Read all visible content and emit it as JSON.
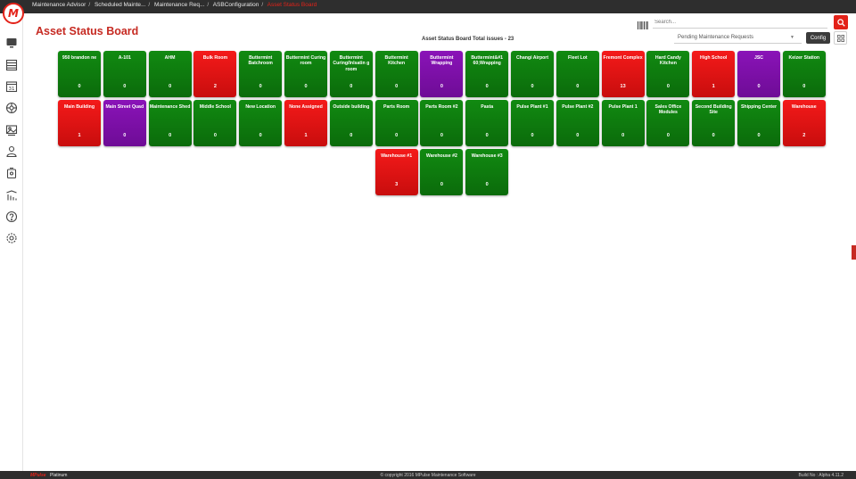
{
  "header": {
    "breadcrumbs": [
      "Maintenance Advisor",
      "Scheduled Mainte...",
      "Maintenance Req...",
      "ASBConfiguration"
    ],
    "current_page": "Asset Status Board"
  },
  "sidebar": {
    "icons": [
      "monitor-icon",
      "list-icon",
      "calendar-icon",
      "asset-icon",
      "gallery-icon",
      "user-icon",
      "inventory-icon",
      "reports-icon",
      "help-icon",
      "settings-icon"
    ],
    "calendar_day": "31"
  },
  "page": {
    "title": "Asset Status Board",
    "total_issues": "Asset Status Board Total issues - 23"
  },
  "search": {
    "placeholder": "Search..."
  },
  "filter": {
    "selected": "Pending Maintenance Requests"
  },
  "config_label": "Config",
  "tiles": [
    {
      "name": "950 brandon ne",
      "count": "0",
      "status": "green"
    },
    {
      "name": "A-101",
      "count": "0",
      "status": "green"
    },
    {
      "name": "AHM",
      "count": "0",
      "status": "green"
    },
    {
      "name": "Bulk Room",
      "count": "2",
      "status": "red"
    },
    {
      "name": "Buttermint Batchroom",
      "count": "0",
      "status": "green"
    },
    {
      "name": "Buttermint Curing room",
      "count": "0",
      "status": "green"
    },
    {
      "name": "Buttermint Curing/Inlsatin g room",
      "count": "0",
      "status": "green"
    },
    {
      "name": "Buttermint Kitchen",
      "count": "0",
      "status": "green"
    },
    {
      "name": "Buttermint Wrapping",
      "count": "0",
      "status": "purple"
    },
    {
      "name": "Buttermint&#1 60;Wrapping",
      "count": "0",
      "status": "green"
    },
    {
      "name": "Changi Airport",
      "count": "0",
      "status": "green"
    },
    {
      "name": "Fleet Lot",
      "count": "0",
      "status": "green"
    },
    {
      "name": "Fremont Complex",
      "count": "13",
      "status": "red"
    },
    {
      "name": "Hard Candy Kitchen",
      "count": "0",
      "status": "green"
    },
    {
      "name": "High School",
      "count": "1",
      "status": "red"
    },
    {
      "name": "JSC",
      "count": "0",
      "status": "purple"
    },
    {
      "name": "Keizer Station",
      "count": "0",
      "status": "green"
    },
    {
      "name": "Main Building",
      "count": "1",
      "status": "red"
    },
    {
      "name": "Main Street Quad",
      "count": "0",
      "status": "purple"
    },
    {
      "name": "Maintenance Shed",
      "count": "0",
      "status": "green"
    },
    {
      "name": "Middle School",
      "count": "0",
      "status": "green"
    },
    {
      "name": "New Location",
      "count": "0",
      "status": "green"
    },
    {
      "name": "None Assigned",
      "count": "1",
      "status": "red"
    },
    {
      "name": "Outside building",
      "count": "0",
      "status": "green"
    },
    {
      "name": "Parts Room",
      "count": "0",
      "status": "green"
    },
    {
      "name": "Parts Room #2",
      "count": "0",
      "status": "green"
    },
    {
      "name": "Pasta",
      "count": "0",
      "status": "green"
    },
    {
      "name": "Pulse Plant #1",
      "count": "0",
      "status": "green"
    },
    {
      "name": "Pulse Plant #2",
      "count": "0",
      "status": "green"
    },
    {
      "name": "Pulse Plant 1",
      "count": "0",
      "status": "green"
    },
    {
      "name": "Sales Office Modules",
      "count": "0",
      "status": "green"
    },
    {
      "name": "Second Building Site",
      "count": "0",
      "status": "green"
    },
    {
      "name": "Shipping Center",
      "count": "0",
      "status": "green"
    },
    {
      "name": "Warehouse",
      "count": "2",
      "status": "red"
    },
    {
      "name": "Warehouse #1",
      "count": "3",
      "status": "red"
    },
    {
      "name": "Warehouse #2",
      "count": "0",
      "status": "green"
    },
    {
      "name": "Warehouse #3",
      "count": "0",
      "status": "green"
    }
  ],
  "footer": {
    "brand": "MPulse",
    "plan": "Platinum",
    "copyright": "© copyright 2016 MPulse Maintenance Software",
    "build": "Build No : Alpha 4.11.2"
  },
  "colors": {
    "accent": "#e32219",
    "green": "#0b7a0b",
    "red": "#e01414",
    "purple": "#7d10a8"
  }
}
